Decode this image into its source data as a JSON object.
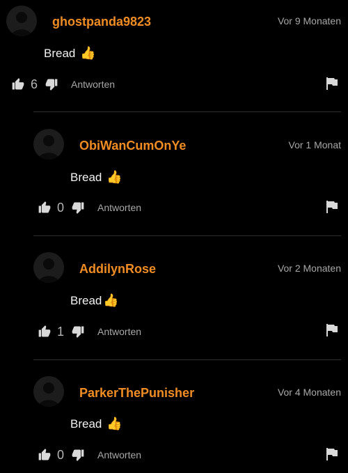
{
  "comments": [
    {
      "username": "ghostpanda9823",
      "timestamp": "Vor 9 Monaten",
      "text": "Bread ",
      "emoji": "👍",
      "likes": "6",
      "reply_label": "Antworten"
    },
    {
      "username": "ObiWanCumOnYe",
      "timestamp": "Vor 1 Monat",
      "text": "Bread ",
      "emoji": "👍",
      "likes": "0",
      "reply_label": "Antworten"
    },
    {
      "username": "AddilynRose",
      "timestamp": "Vor 2 Monaten",
      "text": "Bread",
      "emoji": "👍",
      "likes": "1",
      "reply_label": "Antworten"
    },
    {
      "username": "ParkerThePunisher",
      "timestamp": "Vor 4 Monaten",
      "text": "Bread ",
      "emoji": "👍",
      "likes": "0",
      "reply_label": "Antworten"
    }
  ]
}
